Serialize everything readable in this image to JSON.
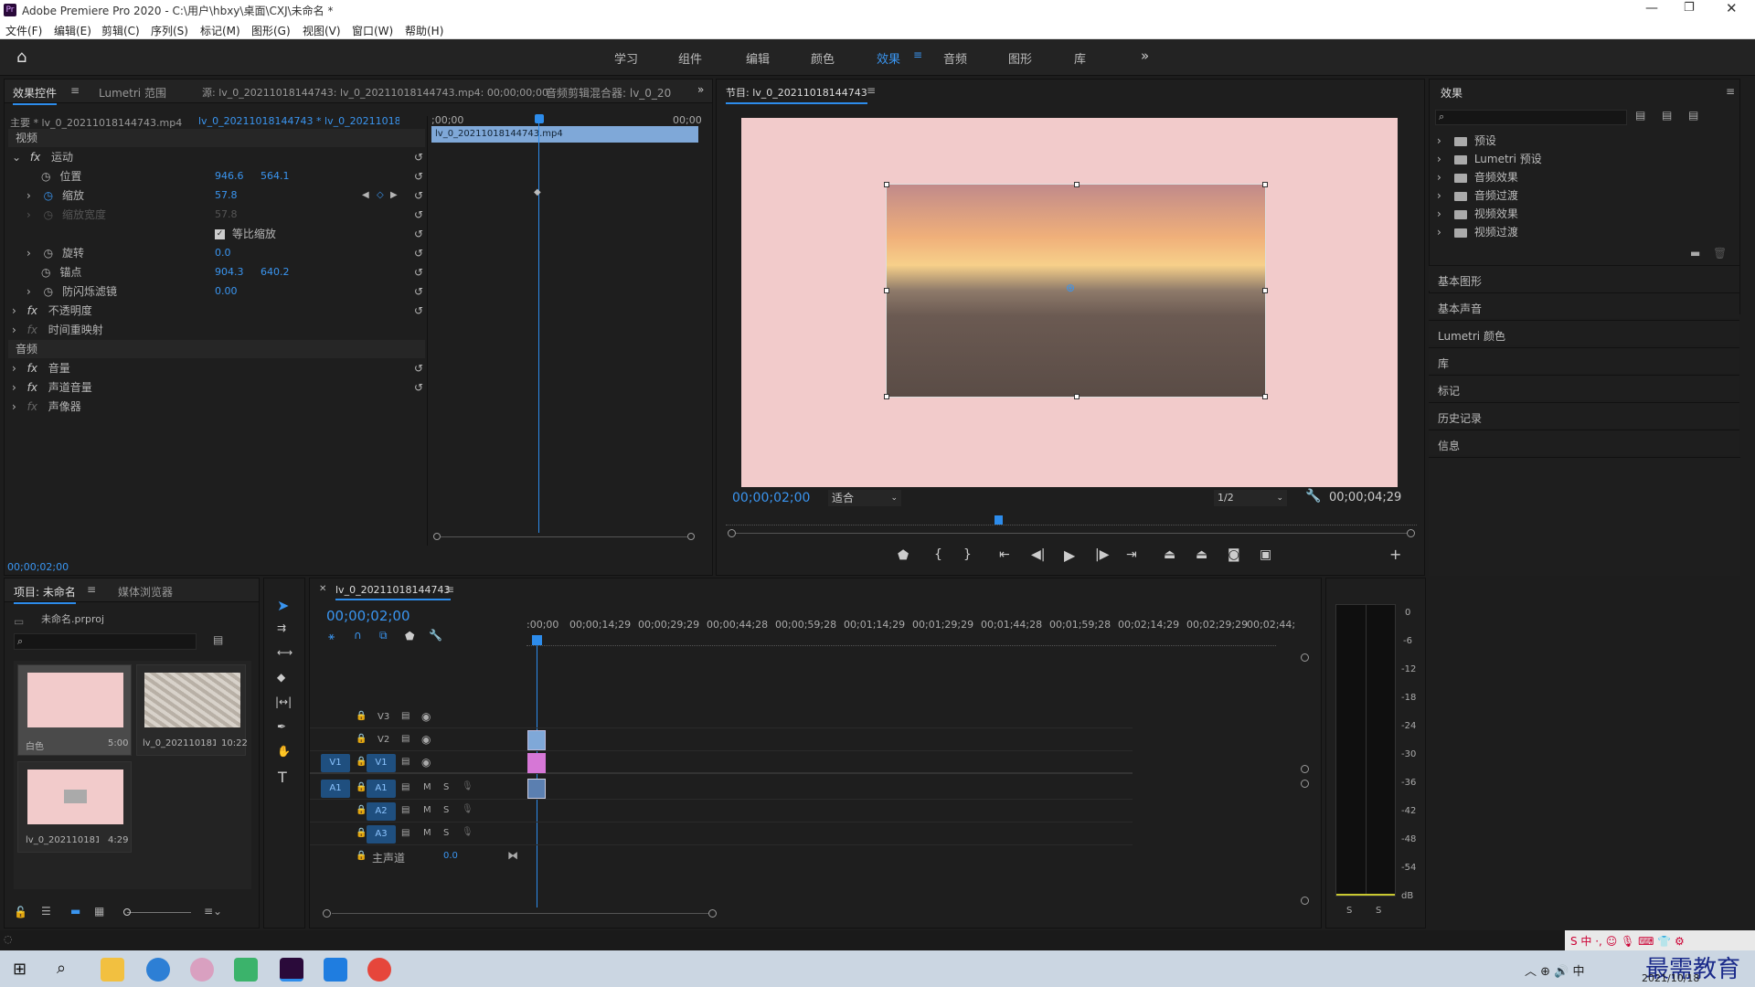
{
  "title": "Adobe Premiere Pro 2020 - C:\\用户\\hbxy\\桌面\\CXJ\\未命名 *",
  "menu": [
    "文件(F)",
    "编辑(E)",
    "剪辑(C)",
    "序列(S)",
    "标记(M)",
    "图形(G)",
    "视图(V)",
    "窗口(W)",
    "帮助(H)"
  ],
  "workspaces": [
    "学习",
    "组件",
    "编辑",
    "颜色",
    "效果",
    "音频",
    "图形",
    "库"
  ],
  "active_workspace": "效果",
  "effect_controls": {
    "tabs": [
      "效果控件",
      "Lumetri 范围",
      "源: lv_0_20211018144743: lv_0_20211018144743.mp4: 00;00;00;00",
      "音频剪辑混合器: lv_0_20"
    ],
    "master": "主要 * lv_0_20211018144743.mp4",
    "seq": "lv_0_20211018144743 * lv_0_2021101814...",
    "ruler_start": ";00;00",
    "ruler_end": "00;00",
    "clip_label": "lv_0_20211018144743.mp4",
    "video_section": "视频",
    "audio_section": "音频",
    "motion": "运动",
    "position": "位置",
    "pos_x": "946.6",
    "pos_y": "564.1",
    "scale": "缩放",
    "scale_val": "57.8",
    "scale_w": "缩放宽度",
    "scale_w_val": "57.8",
    "uniform": "等比缩放",
    "rotation": "旋转",
    "rot_val": "0.0",
    "anchor": "锚点",
    "anc_x": "904.3",
    "anc_y": "640.2",
    "flicker": "防闪烁滤镜",
    "flicker_val": "0.00",
    "opacity": "不透明度",
    "timeremap": "时间重映射",
    "volume": "音量",
    "chvol": "声道音量",
    "panner": "声像器",
    "timecode": "00;00;02;00"
  },
  "program": {
    "title": "节目: lv_0_20211018144743",
    "timecode": "00;00;02;00",
    "fit": "适合",
    "res": "1/2",
    "duration": "00;00;04;29"
  },
  "effects_panel": {
    "title": "效果",
    "items": [
      "预设",
      "Lumetri 预设",
      "音频效果",
      "音频过渡",
      "视频效果",
      "视频过渡"
    ],
    "panels": [
      "基本图形",
      "基本声音",
      "Lumetri 颜色",
      "库",
      "标记",
      "历史记录",
      "信息"
    ]
  },
  "project": {
    "tabs": [
      "项目: 未命名",
      "媒体浏览器"
    ],
    "file": "未命名.prproj",
    "items": [
      {
        "name": "白色",
        "dur": "5:00"
      },
      {
        "name": "lv_0_202110181...",
        "dur": "10:22"
      },
      {
        "name": "lv_0_202110181...",
        "dur": "4:29"
      }
    ]
  },
  "timeline": {
    "tab": "lv_0_20211018144743",
    "timecode": "00;00;02;00",
    "ruler": [
      ":00;00",
      "00;00;14;29",
      "00;00;29;29",
      "00;00;44;28",
      "00;00;59;28",
      "00;01;14;29",
      "00;01;29;29",
      "00;01;44;28",
      "00;01;59;28",
      "00;02;14;29",
      "00;02;29;29",
      "00;02;44;"
    ],
    "tracks": [
      "V3",
      "V2",
      "V1",
      "A1",
      "A2",
      "A3"
    ],
    "src_v": "V1",
    "src_a": "A1",
    "master": "主声道",
    "master_val": "0.0"
  },
  "meter": {
    "labels": [
      "0",
      "-6",
      "-12",
      "-18",
      "-24",
      "-30",
      "-36",
      "-42",
      "-48",
      "-54",
      "dB"
    ],
    "s": "S"
  },
  "taskbar": {
    "date": "2021/10/18",
    "watermark": "最需教育"
  },
  "colors": {
    "accent": "#2d8ceb",
    "canvas": "#f2cbcb",
    "clip_blue": "#7fa8d8",
    "clip_pink": "#d677d6"
  }
}
